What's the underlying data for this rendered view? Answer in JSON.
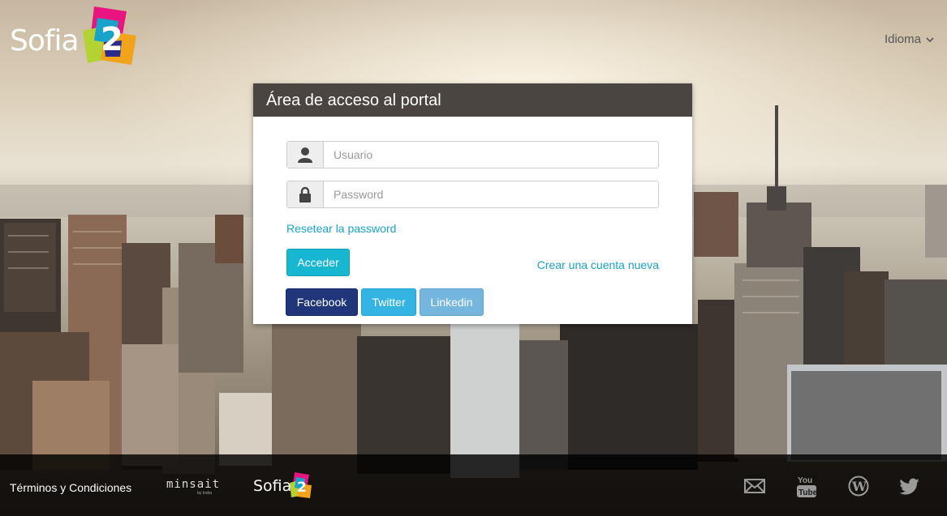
{
  "header": {
    "logo_text": "Sofia",
    "logo_number": "2",
    "language_label": "Idioma"
  },
  "login": {
    "title": "Área de acceso al portal",
    "username_placeholder": "Usuario",
    "password_placeholder": "Password",
    "reset_link": "Resetear la password",
    "submit_label": "Acceder",
    "create_account_link": "Crear una cuenta nueva",
    "social_buttons": {
      "facebook": "Facebook",
      "twitter": "Twitter",
      "linkedin": "Linkedin"
    }
  },
  "footer": {
    "terms_link": "Términos y Condiciones",
    "partner_logo_text": "minsait",
    "partner_logo_sub": "by Indra",
    "logo_text": "Sofia",
    "logo_number": "2",
    "social_icons": [
      "mail-icon",
      "youtube-icon",
      "wordpress-icon",
      "twitter-icon"
    ]
  },
  "colors": {
    "panel_header": "#4a4540",
    "accent": "#18b7d1",
    "link": "#1aa3c8",
    "facebook": "#20357a",
    "twitter": "#34b4e3",
    "linkedin": "#74b6dd",
    "footer_bg": "#000000"
  }
}
